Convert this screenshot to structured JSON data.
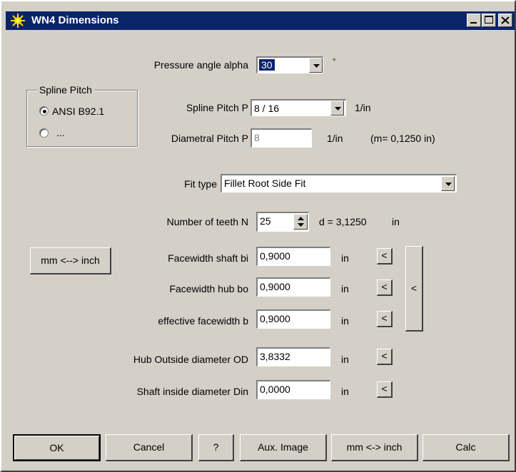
{
  "window": {
    "title": "WN4 Dimensions",
    "minimize_label": "_",
    "maximize_label": "□",
    "close_label": "×"
  },
  "pressure_angle": {
    "label": "Pressure angle alpha",
    "value": "30",
    "unit": "°"
  },
  "spline_pitch_group": {
    "title": "Spline Pitch",
    "options": [
      {
        "label": "ANSI B92.1",
        "selected": true
      },
      {
        "label": "...",
        "selected": false
      }
    ]
  },
  "spline_pitch": {
    "label": "Spline Pitch P",
    "value": "8 / 16",
    "unit": "1/in"
  },
  "diametral_pitch": {
    "label": "Diametral Pitch P",
    "value": "8",
    "unit": "1/in",
    "module_text": "(m= 0,1250 in)"
  },
  "fit_type": {
    "label": "Fit type",
    "value": "Fillet Root Side Fit"
  },
  "teeth": {
    "label": "Number of teeth N",
    "value": "25",
    "d_text": "d = 3,1250",
    "d_unit": "in"
  },
  "mm_inch_side_label": "mm <--> inch",
  "rows": [
    {
      "label": "Facewidth shaft bi",
      "value": "0,9000",
      "unit": "in",
      "btn": "<"
    },
    {
      "label": "Facewidth hub bo",
      "value": "0,9000",
      "unit": "in",
      "btn": "<"
    },
    {
      "label": "effective facewidth b",
      "value": "0,9000",
      "unit": "in",
      "btn": "<"
    },
    {
      "label": "Hub Outside diameter OD",
      "value": "3,8332",
      "unit": "in",
      "btn": "<"
    },
    {
      "label": "Shaft inside diameter  Din",
      "value": "0,0000",
      "unit": "in",
      "btn": "<"
    }
  ],
  "tall_button_label": "<",
  "footer": {
    "ok": "OK",
    "cancel": "Cancel",
    "help": "?",
    "aux_image": "Aux. Image",
    "mm_inch": "mm <-> inch",
    "calc": "Calc"
  }
}
